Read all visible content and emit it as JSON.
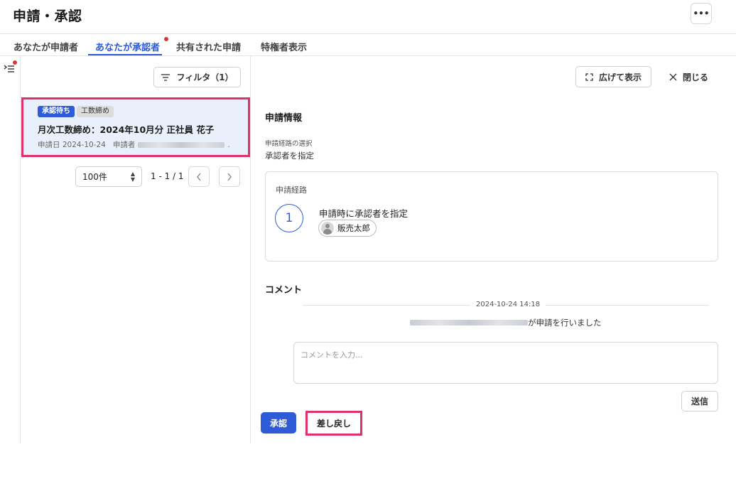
{
  "page": {
    "title": "申請・承認",
    "more_label": "•••"
  },
  "tabs": [
    {
      "label": "あなたが申請者"
    },
    {
      "label": "あなたが承認者",
      "active": true,
      "has_notification": true
    },
    {
      "label": "共有された申請"
    },
    {
      "label": "特権者表示"
    }
  ],
  "rail": {
    "icon": "expand-panel-icon",
    "has_notification": true
  },
  "list": {
    "filter_label": "フィルタ（1）",
    "items": [
      {
        "status_badge": "承認待ち",
        "category_badge": "工数締め",
        "title": "月次工数締め：2024年10月分 正社員 花子",
        "date_label": "申請日 2024-10-24",
        "applicant_label": "申請者",
        "applicant_suffix": "."
      }
    ],
    "pagination": {
      "per_page": "100件",
      "range": "1 - 1 / 1",
      "prev_icon": "chevron-left-icon",
      "next_icon": "chevron-right-icon"
    }
  },
  "detail": {
    "expand_label": "広げて表示",
    "close_label": "閉じる",
    "info_title": "申請情報",
    "route_selection_label": "申請経路の選択",
    "route_selection_value": "承認者を指定",
    "route": {
      "label": "申請経路",
      "steps": [
        {
          "number": "1",
          "text": "申請時に承認者を指定",
          "approver": "販売太郎"
        }
      ]
    },
    "comment": {
      "title": "コメント",
      "entries": [
        {
          "timestamp": "2024-10-24 14:18",
          "message": "が申請を行いました"
        }
      ],
      "input_placeholder": "コメントを入力...",
      "send_label": "送信"
    },
    "actions": {
      "approve_label": "承認",
      "return_label": "差し戻し"
    }
  },
  "colors": {
    "accent": "#2e5bd8",
    "highlight": "#e0306a",
    "notification": "#d8353b",
    "selected_bg": "#eaf0fb"
  }
}
